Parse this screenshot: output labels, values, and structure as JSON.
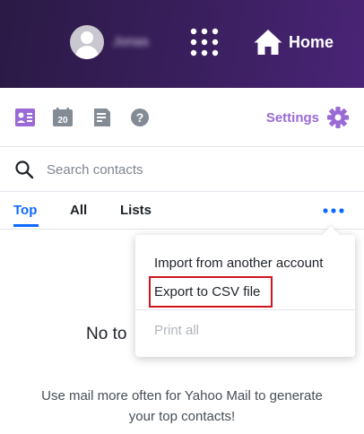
{
  "header": {
    "username": "Jonas",
    "home_label": "Home",
    "icons": {
      "avatar": "user-avatar",
      "apps": "apps-grid-icon",
      "home": "home-icon"
    }
  },
  "toolbar": {
    "icons": [
      "contacts-card-icon",
      "calendar-icon",
      "notepad-icon",
      "help-icon"
    ],
    "calendar_day": "20",
    "settings_label": "Settings",
    "settings_icon": "gear-icon",
    "accent_color": "#9a6ad6"
  },
  "search": {
    "placeholder": "Search contacts",
    "value": ""
  },
  "tabs": {
    "items": [
      {
        "label": "Top",
        "active": true
      },
      {
        "label": "All",
        "active": false
      },
      {
        "label": "Lists",
        "active": false
      }
    ],
    "active_color": "#0f69ff",
    "more_icon": "more-dots-icon"
  },
  "menu": {
    "items": [
      {
        "label": "Import from another account",
        "enabled": true
      },
      {
        "label": "Export to CSV file",
        "enabled": true,
        "highlighted": true
      },
      {
        "label": "Print all",
        "enabled": false
      }
    ],
    "highlight_color": "#d0161d"
  },
  "empty_state": {
    "title": "No to",
    "description": "Use mail more often for Yahoo Mail to generate your top contacts!"
  }
}
